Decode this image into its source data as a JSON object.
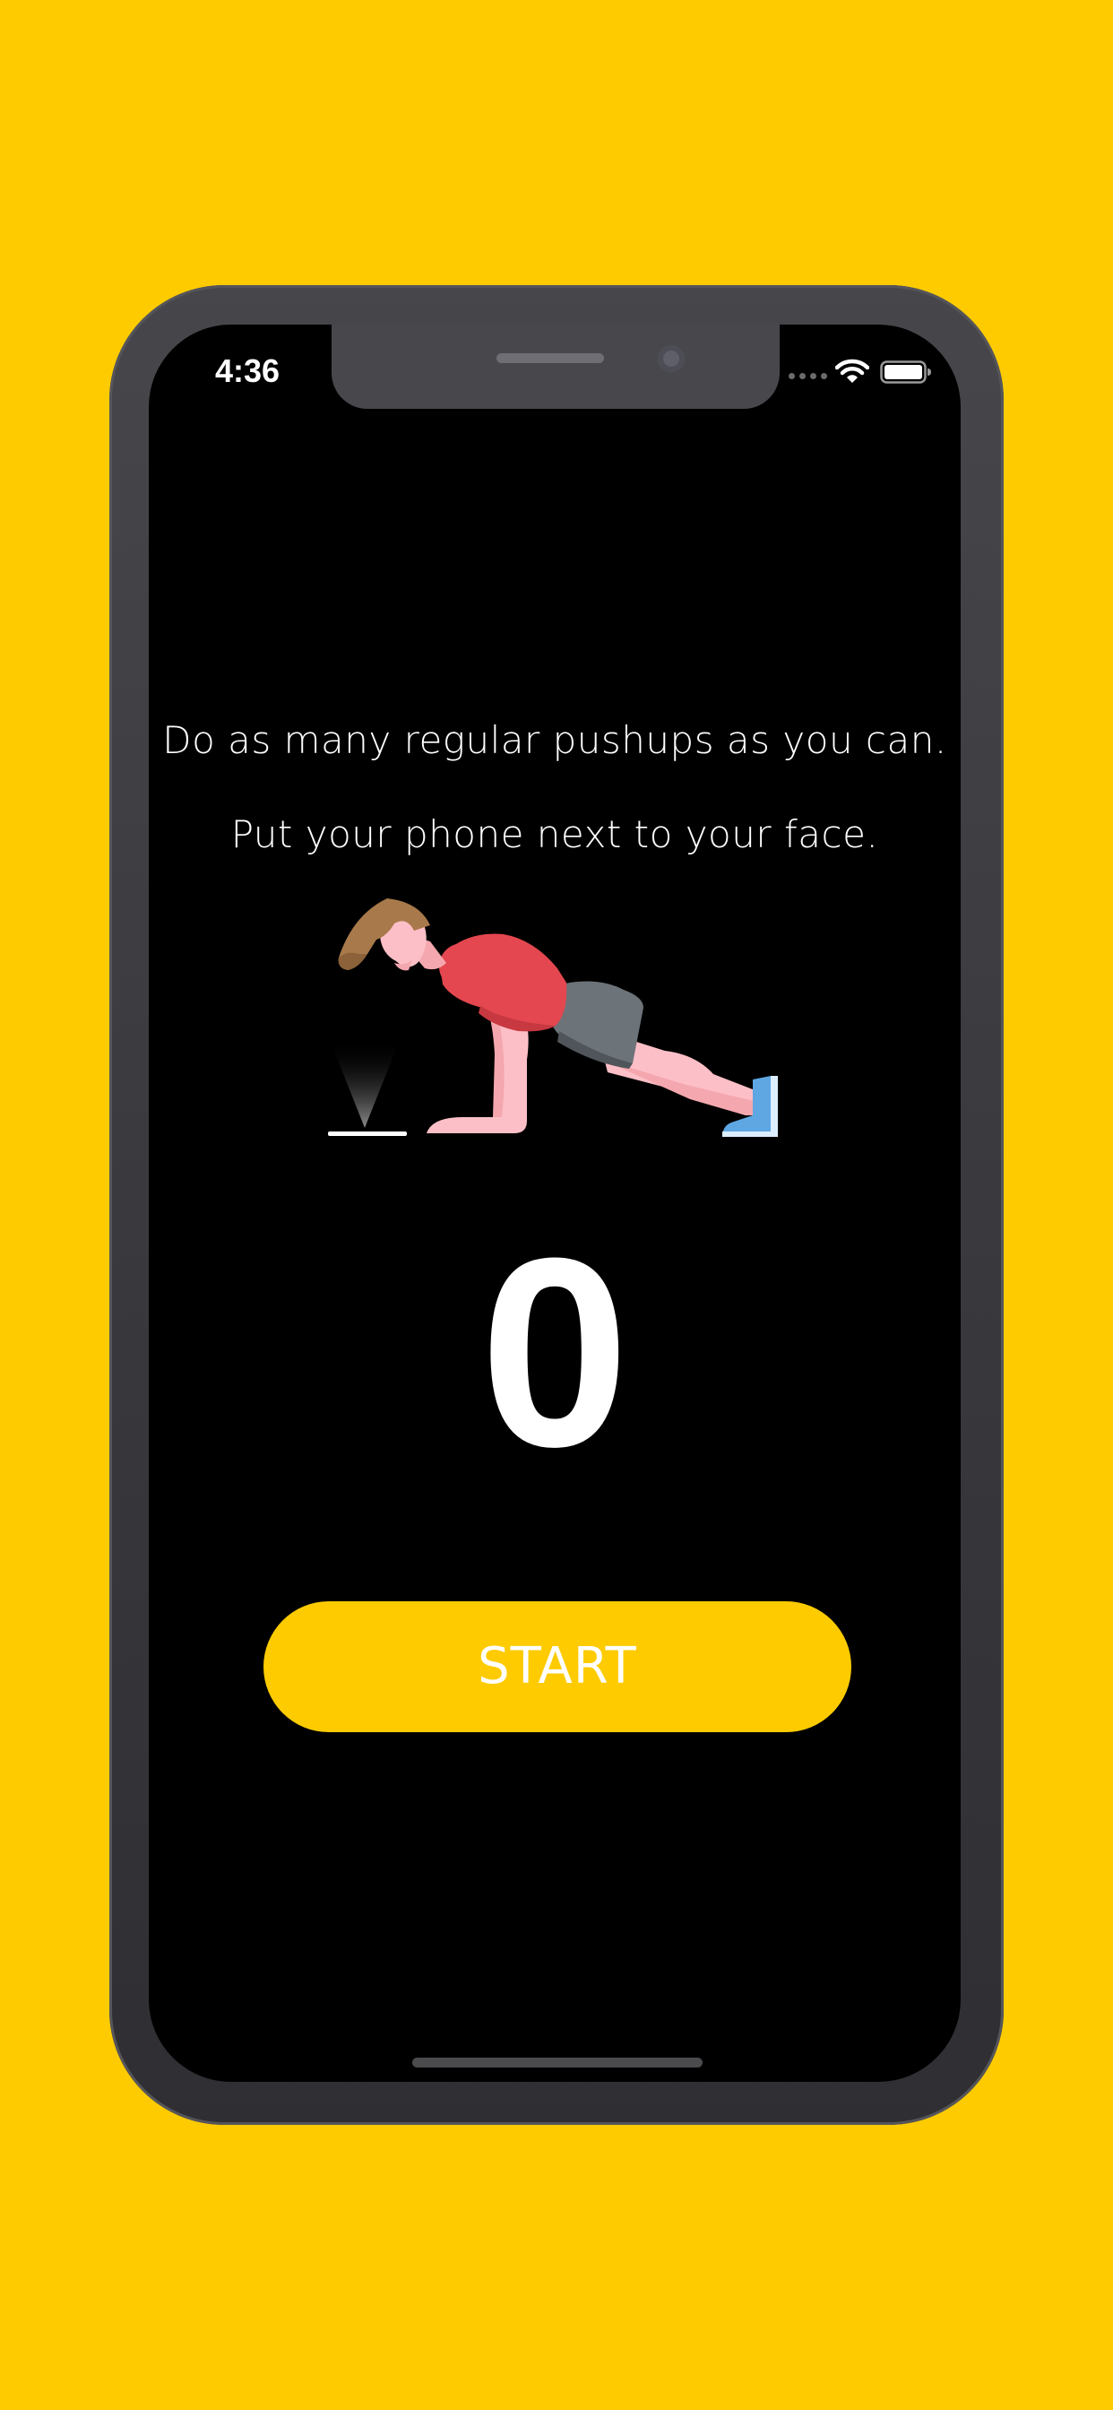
{
  "status_bar": {
    "time": "4:36",
    "icons": [
      "signal-dots-icon",
      "wifi-icon",
      "battery-icon"
    ]
  },
  "instructions": {
    "line1": "Do as many regular pushups as you can.",
    "line2": "Put your phone next to your face."
  },
  "illustration": {
    "icon": "pushup-illustration"
  },
  "counter": {
    "value": "0"
  },
  "start_button": {
    "label": "START"
  },
  "colors": {
    "background": "#FDCB00",
    "accent": "#FDCB00",
    "screen": "#000000",
    "text": "#FFFFFF"
  }
}
